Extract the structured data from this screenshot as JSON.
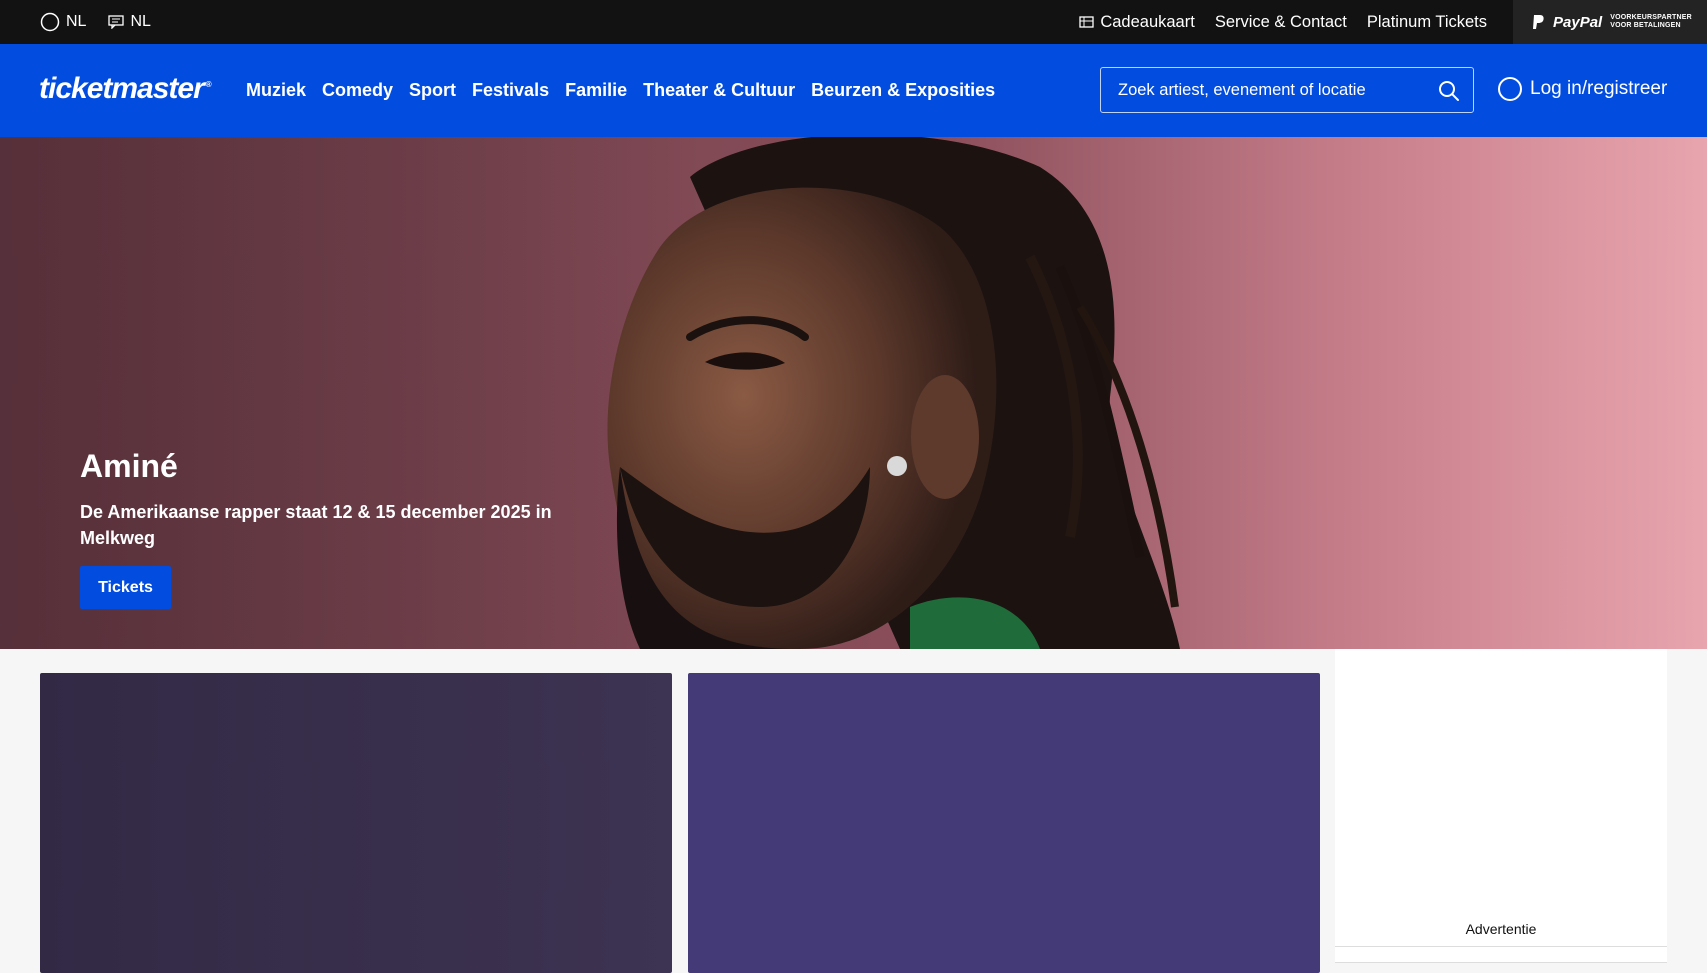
{
  "topbar": {
    "country_label": "NL",
    "language_label": "NL",
    "links": [
      "Cadeaukaart",
      "Service & Contact",
      "Platinum Tickets"
    ],
    "paypal_brand": "PayPal",
    "paypal_tagline_1": "VOORKEURSPARTNER",
    "paypal_tagline_2": "VOOR BETALINGEN"
  },
  "nav": {
    "logo": "ticketmaster",
    "logo_mark": "®",
    "menu": [
      "Muziek",
      "Comedy",
      "Sport",
      "Festivals",
      "Familie",
      "Theater & Cultuur",
      "Beurzen & Exposities"
    ],
    "search_placeholder": "Zoek artiest, evenement of locatie",
    "login_label": "Log in/registreer"
  },
  "hero": {
    "title": "Aminé",
    "subtitle": "De Amerikaanse rapper staat 12 & 15 december 2025 in Melkweg",
    "cta_label": "Tickets"
  },
  "ad": {
    "label": "Advertentie"
  },
  "colors": {
    "brand_blue": "#024ddf",
    "topbar_bg": "#121212",
    "card_1": "#3a304d",
    "card_2": "#443a78"
  }
}
